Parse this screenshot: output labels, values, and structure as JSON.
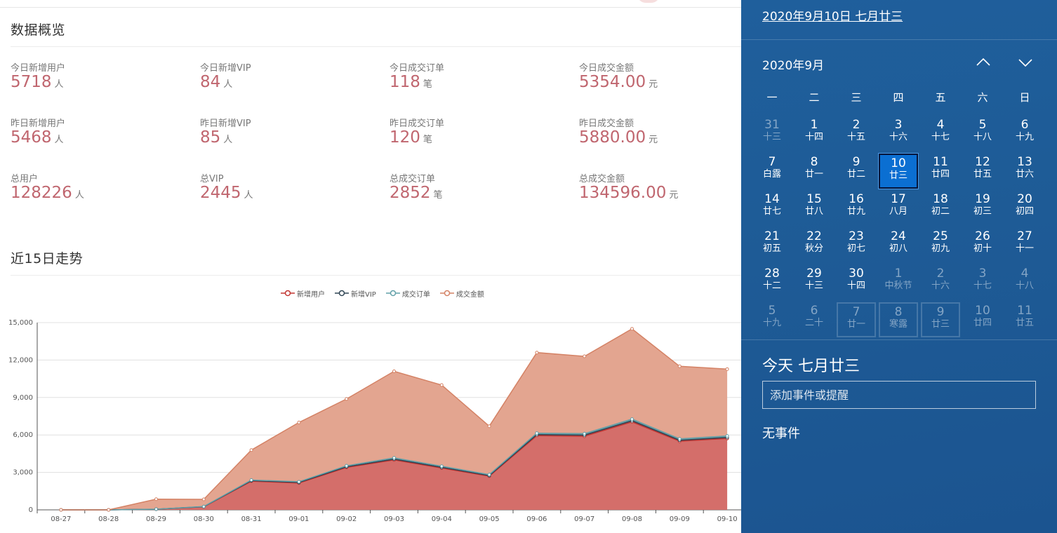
{
  "overview": {
    "title": "数据概览",
    "stats": [
      {
        "label": "今日新增用户",
        "value": "5718",
        "unit": "人"
      },
      {
        "label": "今日新增VIP",
        "value": "84",
        "unit": "人"
      },
      {
        "label": "今日成交订单",
        "value": "118",
        "unit": "笔"
      },
      {
        "label": "今日成交金额",
        "value": "5354.00",
        "unit": "元"
      },
      {
        "label": "昨日新增用户",
        "value": "5468",
        "unit": "人"
      },
      {
        "label": "昨日新增VIP",
        "value": "85",
        "unit": "人"
      },
      {
        "label": "昨日成交订单",
        "value": "120",
        "unit": "笔"
      },
      {
        "label": "昨日成交金额",
        "value": "5880.00",
        "unit": "元"
      },
      {
        "label": "总用户",
        "value": "128226",
        "unit": "人"
      },
      {
        "label": "总VIP",
        "value": "2445",
        "unit": "人"
      },
      {
        "label": "总成交订单",
        "value": "2852",
        "unit": "笔"
      },
      {
        "label": "总成交金额",
        "value": "134596.00",
        "unit": "元"
      }
    ]
  },
  "trend": {
    "title": "近15日走势",
    "legend": [
      "新增用户",
      "新增VIP",
      "成交订单",
      "成交金额"
    ]
  },
  "chart_data": {
    "type": "area",
    "stacked": true,
    "categories": [
      "08-27",
      "08-28",
      "08-29",
      "08-30",
      "08-31",
      "09-01",
      "09-02",
      "09-03",
      "09-04",
      "09-05",
      "09-06",
      "09-07",
      "09-08",
      "09-09",
      "09-10"
    ],
    "series": [
      {
        "name": "新增用户",
        "values": [
          0,
          0,
          50,
          250,
          2300,
          2150,
          3400,
          4000,
          3350,
          2700,
          5950,
          5900,
          7050,
          5500,
          5718
        ]
      },
      {
        "name": "新增VIP",
        "values": [
          0,
          0,
          2,
          5,
          40,
          45,
          55,
          70,
          60,
          50,
          85,
          90,
          95,
          80,
          84
        ]
      },
      {
        "name": "成交订单",
        "values": [
          0,
          0,
          3,
          8,
          50,
          55,
          75,
          95,
          85,
          70,
          110,
          115,
          125,
          110,
          118
        ]
      },
      {
        "name": "成交金额",
        "values": [
          0,
          0,
          800,
          580,
          2400,
          4750,
          5350,
          6935,
          6505,
          3880,
          6455,
          6195,
          7230,
          5810,
          5354
        ]
      }
    ],
    "yticks": [
      "0",
      "3,000",
      "6,000",
      "9,000",
      "12,000",
      "15,000"
    ],
    "ylim": [
      0,
      15000
    ],
    "grid": true,
    "legend_position": "top",
    "colors": [
      "#c23531",
      "#2f4554",
      "#61a0a8",
      "#d48265"
    ]
  },
  "calendar": {
    "header_date": "2020年9月10日 七月廿三",
    "month_label": "2020年9月",
    "weekdays": [
      "一",
      "二",
      "三",
      "四",
      "五",
      "六",
      "日"
    ],
    "days": [
      {
        "d": "31",
        "l": "十三",
        "dim": true
      },
      {
        "d": "1",
        "l": "十四"
      },
      {
        "d": "2",
        "l": "十五"
      },
      {
        "d": "3",
        "l": "十六"
      },
      {
        "d": "4",
        "l": "十七"
      },
      {
        "d": "5",
        "l": "十八"
      },
      {
        "d": "6",
        "l": "十九"
      },
      {
        "d": "7",
        "l": "白露"
      },
      {
        "d": "8",
        "l": "廿一"
      },
      {
        "d": "9",
        "l": "廿二"
      },
      {
        "d": "10",
        "l": "廿三",
        "today": true
      },
      {
        "d": "11",
        "l": "廿四"
      },
      {
        "d": "12",
        "l": "廿五"
      },
      {
        "d": "13",
        "l": "廿六"
      },
      {
        "d": "14",
        "l": "廿七"
      },
      {
        "d": "15",
        "l": "廿八"
      },
      {
        "d": "16",
        "l": "廿九"
      },
      {
        "d": "17",
        "l": "八月"
      },
      {
        "d": "18",
        "l": "初二"
      },
      {
        "d": "19",
        "l": "初三"
      },
      {
        "d": "20",
        "l": "初四"
      },
      {
        "d": "21",
        "l": "初五"
      },
      {
        "d": "22",
        "l": "秋分"
      },
      {
        "d": "23",
        "l": "初七"
      },
      {
        "d": "24",
        "l": "初八"
      },
      {
        "d": "25",
        "l": "初九"
      },
      {
        "d": "26",
        "l": "初十"
      },
      {
        "d": "27",
        "l": "十一"
      },
      {
        "d": "28",
        "l": "十二"
      },
      {
        "d": "29",
        "l": "十三"
      },
      {
        "d": "30",
        "l": "十四"
      },
      {
        "d": "1",
        "l": "中秋节",
        "dim": true
      },
      {
        "d": "2",
        "l": "十六",
        "dim": true
      },
      {
        "d": "3",
        "l": "十七",
        "dim": true
      },
      {
        "d": "4",
        "l": "十八",
        "dim": true
      },
      {
        "d": "5",
        "l": "十九",
        "dim": true
      },
      {
        "d": "6",
        "l": "二十",
        "dim": true
      },
      {
        "d": "7",
        "l": "廿一",
        "dim": true,
        "boxed": true
      },
      {
        "d": "8",
        "l": "寒露",
        "dim": true,
        "boxed": true
      },
      {
        "d": "9",
        "l": "廿三",
        "dim": true,
        "boxed": true
      },
      {
        "d": "10",
        "l": "廿四",
        "dim": true
      },
      {
        "d": "11",
        "l": "廿五",
        "dim": true
      }
    ],
    "today_label": "今天 七月廿三",
    "event_placeholder": "添加事件或提醒",
    "no_events": "无事件",
    "nav_up_icon": "chevron-up-icon",
    "nav_down_icon": "chevron-down-icon"
  }
}
